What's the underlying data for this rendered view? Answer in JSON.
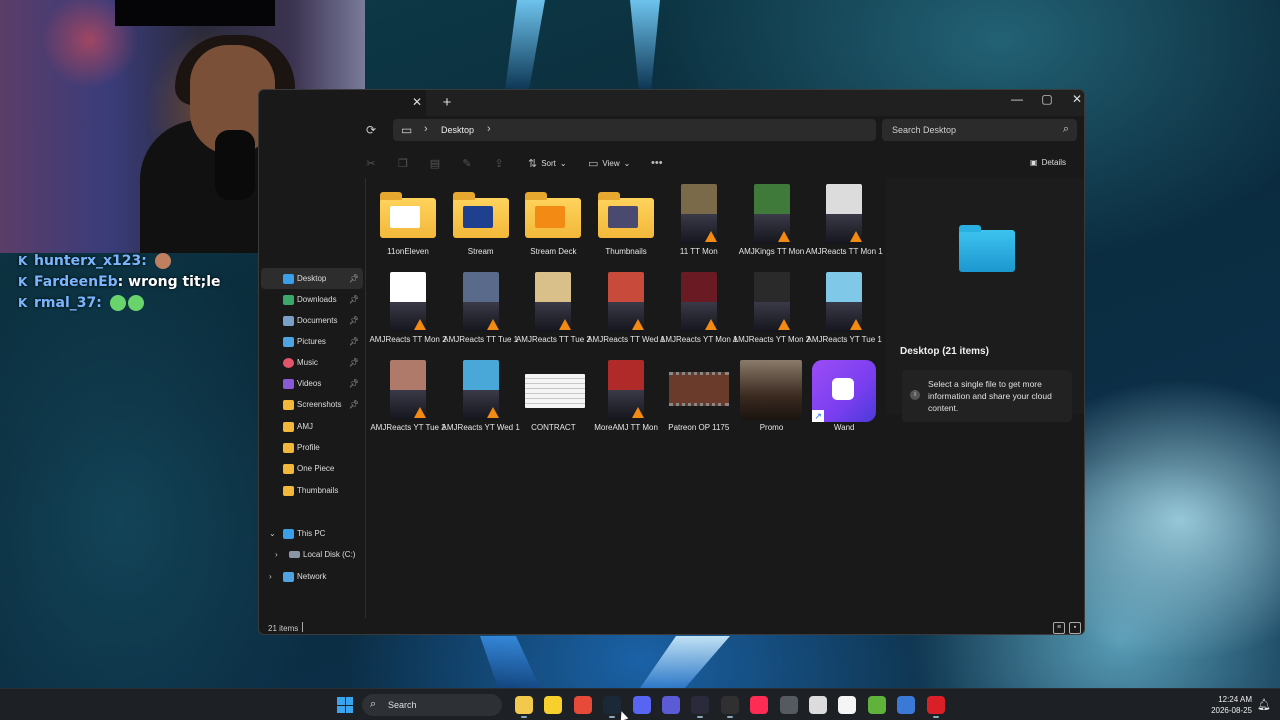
{
  "chat": [
    {
      "user": "hunterx_x123:",
      "message": ""
    },
    {
      "user": "FardeenEb",
      "message": ": wrong tit;le"
    },
    {
      "user": "rmal_37:",
      "message": ""
    }
  ],
  "explorer": {
    "address": {
      "location": "Desktop"
    },
    "search": {
      "placeholder": "Search Desktop"
    },
    "toolbar": {
      "sort": "Sort",
      "view": "View",
      "details": "Details"
    },
    "sidebar": {
      "quick_access": [
        {
          "label": "Desktop",
          "icon": "desktop-icon",
          "color": "#3a9ee8"
        },
        {
          "label": "Downloads",
          "icon": "download-icon",
          "color": "#3aa86a"
        },
        {
          "label": "Documents",
          "icon": "document-icon",
          "color": "#7aa0c8"
        },
        {
          "label": "Pictures",
          "icon": "picture-icon",
          "color": "#4fa3e0"
        },
        {
          "label": "Music",
          "icon": "music-icon",
          "color": "#e0556a"
        },
        {
          "label": "Videos",
          "icon": "video-icon",
          "color": "#8a5ad6"
        },
        {
          "label": "Screenshots",
          "icon": "folder-icon",
          "color": "#f2b83a"
        },
        {
          "label": "AMJ",
          "icon": "folder-icon",
          "color": "#f2b83a"
        },
        {
          "label": "Profile",
          "icon": "folder-icon",
          "color": "#f2b83a"
        },
        {
          "label": "One Piece",
          "icon": "folder-icon",
          "color": "#f2b83a"
        },
        {
          "label": "Thumbnails",
          "icon": "folder-icon",
          "color": "#f2b83a"
        }
      ],
      "this_pc": "This PC",
      "local_disk": "Local Disk (C:)",
      "network": "Network"
    },
    "files": [
      {
        "name": "11onEleven",
        "kind": "folder",
        "accent": "#ffffff"
      },
      {
        "name": "Stream",
        "kind": "folder",
        "accent": "#1f3f8f"
      },
      {
        "name": "Stream Deck",
        "kind": "folder",
        "accent": "#f28a14"
      },
      {
        "name": "Thumbnails",
        "kind": "folder",
        "accent": "#4a4a70"
      },
      {
        "name": "11 TT Mon",
        "kind": "video",
        "accent": "#7b6a4a"
      },
      {
        "name": "AMJKings TT Mon",
        "kind": "video",
        "accent": "#3f7a3a"
      },
      {
        "name": "AMJReacts TT Mon 1",
        "kind": "video",
        "accent": "#dcdcdc"
      },
      {
        "name": "AMJReacts TT Mon 2",
        "kind": "video",
        "accent": "#ffffff"
      },
      {
        "name": "AMJReacts TT Tue 1",
        "kind": "video",
        "accent": "#5a6a8a"
      },
      {
        "name": "AMJReacts TT Tue 2",
        "kind": "video",
        "accent": "#d9c08a"
      },
      {
        "name": "AMJReacts TT Wed 1",
        "kind": "video",
        "accent": "#c84a3a"
      },
      {
        "name": "AMJReacts YT Mon 1",
        "kind": "video",
        "accent": "#6a1a22"
      },
      {
        "name": "AMJReacts YT Mon 2",
        "kind": "video",
        "accent": "#2a2a2a"
      },
      {
        "name": "AMJReacts YT Tue 1",
        "kind": "video",
        "accent": "#7fc8e8"
      },
      {
        "name": "AMJReacts YT Tue 2",
        "kind": "video",
        "accent": "#b07a6a"
      },
      {
        "name": "AMJReacts YT Wed 1",
        "kind": "video",
        "accent": "#4aa8d8"
      },
      {
        "name": "CONTRACT",
        "kind": "document",
        "accent": "#f4f4f4"
      },
      {
        "name": "MoreAMJ TT Mon",
        "kind": "video",
        "accent": "#b02a2a"
      },
      {
        "name": "Patreon OP 1175",
        "kind": "wide-video",
        "accent": "#6a3a2a"
      },
      {
        "name": "Promo",
        "kind": "image",
        "accent": "#3a2a20"
      },
      {
        "name": "Wand",
        "kind": "app",
        "accent": "#7a3ef0"
      }
    ],
    "details": {
      "title": "Desktop (21 items)",
      "message": "Select a single file to get more information and share your cloud content."
    },
    "status": {
      "count": "21 items"
    }
  },
  "taskbar": {
    "search_label": "Search",
    "apps": [
      {
        "icon": "file-explorer-icon",
        "color": "#f2c94c",
        "running": true
      },
      {
        "icon": "sticky-notes-icon",
        "color": "#f7d02c",
        "running": false
      },
      {
        "icon": "chrome-icon",
        "color": "#e84a3a",
        "running": false
      },
      {
        "icon": "steam-icon",
        "color": "#1b2838",
        "running": true
      },
      {
        "icon": "discord-icon",
        "color": "#5865f2",
        "running": false
      },
      {
        "icon": "streamlabs-icon",
        "color": "#5b5bd6",
        "running": false
      },
      {
        "icon": "stream-deck-icon",
        "color": "#2a2a3a",
        "running": true
      },
      {
        "icon": "obs-icon",
        "color": "#303030",
        "running": true
      },
      {
        "icon": "tiktok-icon",
        "color": "#fe2c55",
        "running": false
      },
      {
        "icon": "settings-icon",
        "color": "#555a60",
        "running": false
      },
      {
        "icon": "wheel-icon",
        "color": "#dcdcdc",
        "running": false
      },
      {
        "icon": "itunes-icon",
        "color": "#f5f5f5",
        "running": false
      },
      {
        "icon": "utorrent-icon",
        "color": "#5fb33a",
        "running": false
      },
      {
        "icon": "layers-icon",
        "color": "#3a7ad6",
        "running": false
      },
      {
        "icon": "creative-cloud-icon",
        "color": "#da1f26",
        "running": true
      }
    ],
    "time": "12:24 AM",
    "date": "2026-08-25"
  }
}
